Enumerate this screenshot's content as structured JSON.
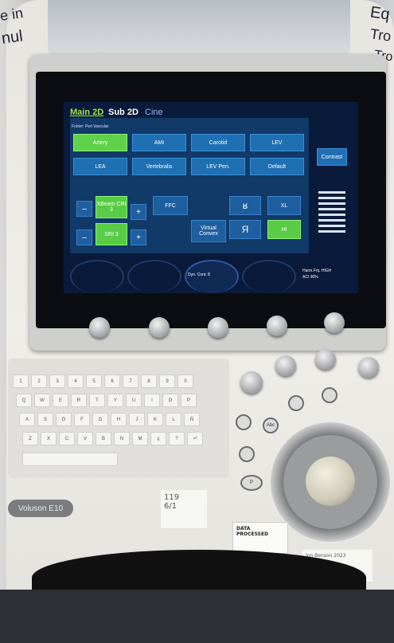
{
  "environment": {
    "wall_text": [
      "e in",
      "nul",
      "Eq",
      "Tro",
      "Tro"
    ]
  },
  "screen": {
    "tabs": [
      "Main 2D",
      "Sub 2D",
      "Cine"
    ],
    "folder": "Folder: Peri Vascular",
    "presets": [
      {
        "label": "Artery",
        "active": true
      },
      {
        "label": "AMI",
        "active": false
      },
      {
        "label": "Carotid",
        "active": false
      },
      {
        "label": "LEV",
        "active": false
      },
      {
        "label": "LEA",
        "active": false
      },
      {
        "label": "Vertebralis",
        "active": false
      },
      {
        "label": "LEV Pen.",
        "active": false
      },
      {
        "label": "Default",
        "active": false
      }
    ],
    "contrast": "Contrast",
    "controls": {
      "xbeam": "XBeam CRI 3",
      "sri": "SRI 3",
      "ffc": "FFC",
      "virtual_convex": "Virtual Convex",
      "xl": "XL",
      "hi": "HI",
      "minus": "–",
      "plus": "+",
      "flip_ud": "ʁ",
      "flip_lr": "Я"
    },
    "status": {
      "dyn_cont": "Dyn. Cont. 8",
      "harm_freq": "Harm.Frq. HIGH",
      "aci": "ACI 90%"
    }
  },
  "keyboard": {
    "rows": [
      [
        "1",
        "2",
        "3",
        "4",
        "5",
        "6",
        "7",
        "8",
        "9",
        "0"
      ],
      [
        "Q",
        "W",
        "E",
        "R",
        "T",
        "Y",
        "U",
        "I",
        "O",
        "P"
      ],
      [
        "A",
        "S",
        "D",
        "F",
        "G",
        "H",
        "J",
        "K",
        "L",
        "Ñ"
      ],
      [
        "Z",
        "X",
        "C",
        "V",
        "B",
        "N",
        "M",
        "ç",
        "?",
        "⏎"
      ]
    ]
  },
  "side_buttons": [
    "Abc",
    "P"
  ],
  "logo": "Voluson E10",
  "notes": {
    "note_1_line1": "119",
    "note_1_line2": "6/1",
    "sticker_line1": "DATA",
    "sticker_line2": "PROCESSED",
    "label_line1": "Jon Benson 2023",
    "label_line2": "124"
  }
}
